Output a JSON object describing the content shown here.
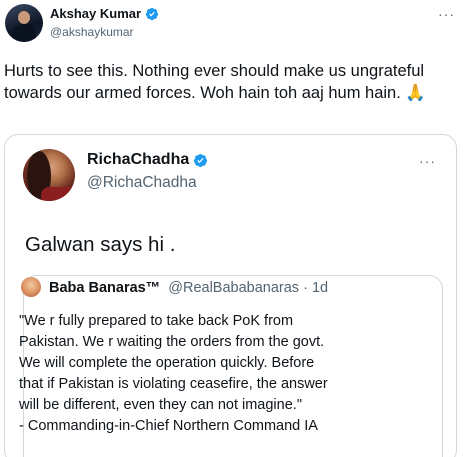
{
  "outer_tweet": {
    "display_name": "Akshay Kumar",
    "handle": "@akshaykumar",
    "more": "···",
    "text": "Hurts to see this. Nothing ever should make us ungrateful towards our armed forces. Woh hain toh aaj hum hain. 🙏"
  },
  "quoted_tweet": {
    "display_name": "RichaChadha",
    "handle": "@RichaChadha",
    "more": "···",
    "text": "Galwan says hi ."
  },
  "inner_quote": {
    "display_name": "Baba Banaras™",
    "handle_time": "@RealBababanaras · 1d",
    "lines": [
      "\"We r fully prepared to take back PoK from",
      "Pakistan. We r waiting the orders from the govt.",
      "We will complete the operation quickly. Before",
      "that if Pakistan is violating ceasefire, the answer",
      "will be different, even they can not imagine.\"",
      "- Commanding-in-Chief Northern Command IA"
    ]
  },
  "colors": {
    "verified_badge": "#1d9bf0",
    "secondary_text": "#536471",
    "border": "#cfd9de"
  },
  "icons": [
    "verified-badge-icon",
    "more-options-icon",
    "folded-hands-emoji"
  ]
}
